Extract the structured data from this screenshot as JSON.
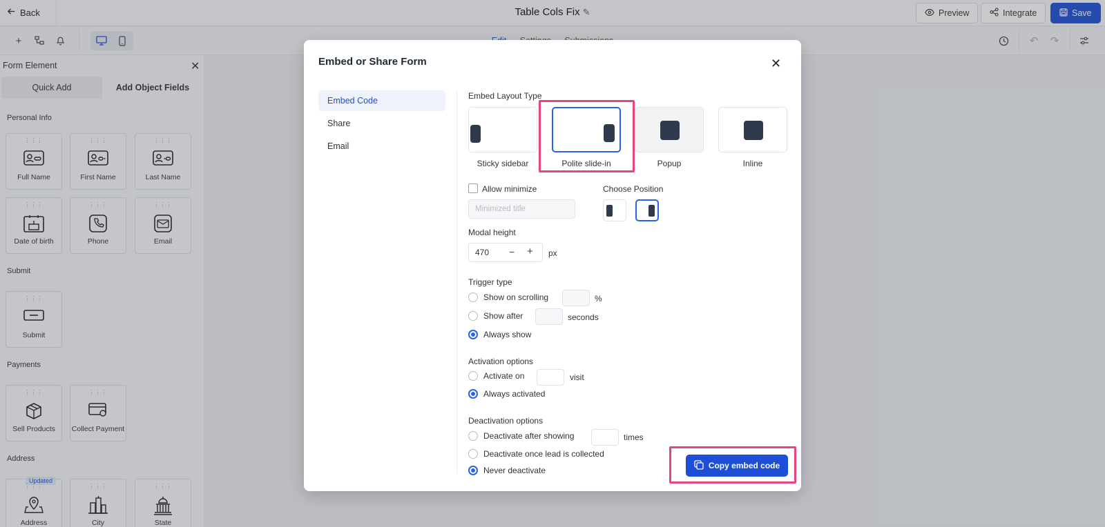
{
  "topbar": {
    "back_label": "Back",
    "title": "Table Cols Fix",
    "preview_label": "Preview",
    "integrate_label": "Integrate",
    "save_label": "Save"
  },
  "toolbar": {
    "tabs": [
      "Edit",
      "Settings",
      "Submissions"
    ],
    "active_tab": "Edit"
  },
  "left_panel": {
    "header": "Form Element",
    "tabs": [
      "Quick Add",
      "Add Object Fields"
    ],
    "sections": {
      "personal_info": "Personal Info",
      "submit": "Submit",
      "payments": "Payments",
      "address": "Address"
    },
    "personal_fields": [
      "Full Name",
      "First Name",
      "Last Name",
      "Date of birth",
      "Phone",
      "Email"
    ],
    "submit_fields": [
      "Submit"
    ],
    "payment_fields": [
      "Sell Products",
      "Collect Payment"
    ],
    "address_fields": [
      "Address",
      "City",
      "State"
    ],
    "updated_badge": "Updated"
  },
  "modal": {
    "title": "Embed or Share Form",
    "nav": [
      "Embed Code",
      "Share",
      "Email"
    ],
    "active_nav": "Embed Code",
    "embed_layout_label": "Embed Layout Type",
    "layouts": [
      "Sticky sidebar",
      "Polite slide-in",
      "Popup",
      "Inline"
    ],
    "selected_layout": "Polite slide-in",
    "allow_minimize_label": "Allow minimize",
    "allow_minimize_checked": false,
    "minimized_title_placeholder": "Minimized title",
    "choose_position_label": "Choose Position",
    "selected_position": "right",
    "modal_height_label": "Modal height",
    "modal_height_value": "470",
    "modal_height_unit": "px",
    "trigger_type_label": "Trigger type",
    "trigger_options": {
      "scrolling": "Show on scrolling",
      "scrolling_unit": "%",
      "after": "Show after",
      "after_unit": "seconds",
      "always": "Always show"
    },
    "trigger_selected": "Always show",
    "activation_label": "Activation options",
    "activation_options": {
      "activate_on": "Activate on",
      "activate_unit": "visit",
      "always": "Always activated"
    },
    "activation_selected": "Always activated",
    "deactivation_label": "Deactivation options",
    "deactivation_options": {
      "after_showing": "Deactivate after showing",
      "after_unit": "times",
      "lead_collected": "Deactivate once lead is collected",
      "never": "Never deactivate"
    },
    "deactivation_selected": "Never deactivate",
    "copy_button_label": "Copy embed code"
  },
  "colors": {
    "accent": "#1d4ed8",
    "highlight": "#e8457a",
    "block": "#2f3a4c"
  }
}
